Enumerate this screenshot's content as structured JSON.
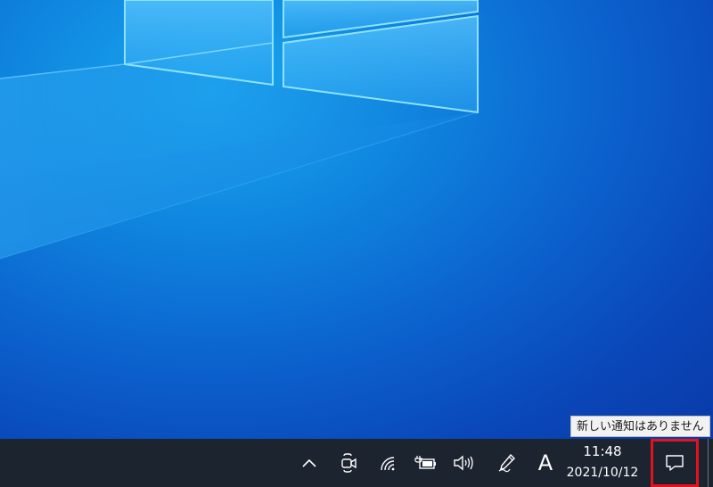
{
  "taskbar": {
    "background": "#1c2430",
    "tray_icons": [
      {
        "name": "show-hidden-icons",
        "icon": "chevron-up-icon"
      },
      {
        "name": "meet-now",
        "icon": "video-camera-icon"
      },
      {
        "name": "network",
        "icon": "wifi-icon"
      },
      {
        "name": "battery",
        "icon": "battery-charging-icon"
      },
      {
        "name": "volume",
        "icon": "speaker-icon"
      },
      {
        "name": "pen-workspace",
        "icon": "pen-icon"
      }
    ],
    "ime_indicator": "A",
    "clock": {
      "time": "11:48",
      "date": "2021/10/12"
    },
    "notification_button": {
      "icon": "message-bubble-icon",
      "highlight_color": "#e0141e"
    }
  },
  "tooltip": {
    "text": "新しい通知はありません"
  },
  "wallpaper": {
    "colors": [
      "#1aa8f0",
      "#0f86df",
      "#0b5fcc",
      "#0a3aa8"
    ]
  }
}
